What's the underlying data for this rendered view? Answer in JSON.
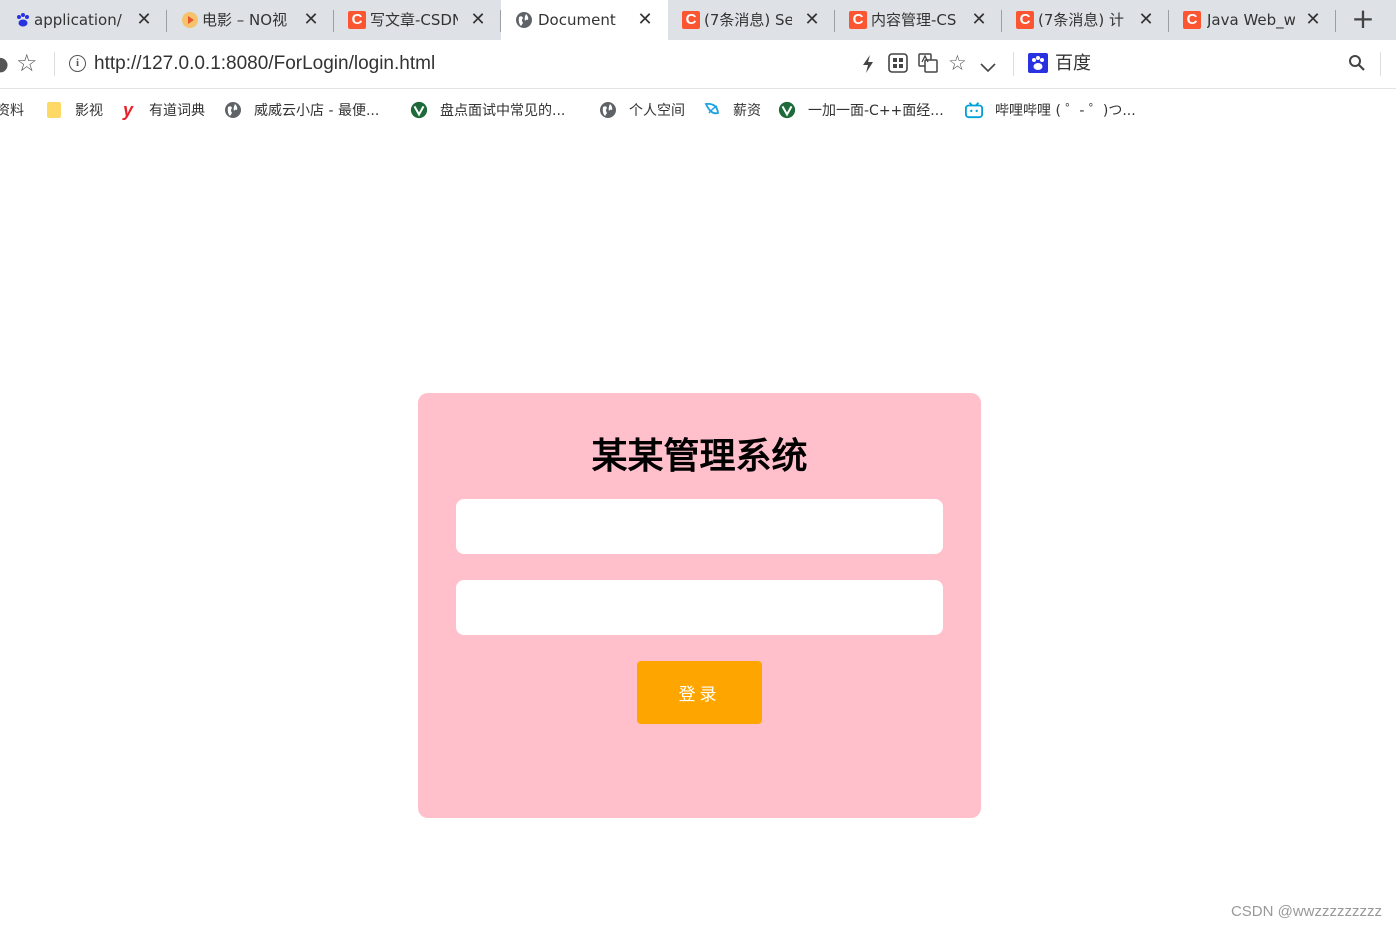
{
  "browser": {
    "tabs": [
      {
        "title": "application/",
        "favicon": "baidu-paw-icon",
        "active": false
      },
      {
        "title": "电影 – NO视",
        "favicon": "video-play-icon",
        "active": false
      },
      {
        "title": "写文章-CSDN",
        "favicon": "csdn-icon",
        "active": false
      },
      {
        "title": "Document",
        "favicon": "globe-icon",
        "active": true
      },
      {
        "title": "(7条消息) Se",
        "favicon": "csdn-icon",
        "active": false
      },
      {
        "title": "内容管理-CS",
        "favicon": "csdn-icon",
        "active": false
      },
      {
        "title": "(7条消息) 计",
        "favicon": "csdn-icon",
        "active": false
      },
      {
        "title": "Java Web_w",
        "favicon": "csdn-icon",
        "active": false
      }
    ],
    "close_glyph": "✕",
    "new_tab_glyph": "+",
    "address": "http://127.0.0.1:8080/ForLogin/login.html",
    "search_engine": "百度",
    "bookmarks": [
      {
        "label": "资料",
        "icon": "baidu-paw-icon"
      },
      {
        "label": "影视",
        "icon": "folder-icon"
      },
      {
        "label": "有道词典",
        "icon": "youdao-icon"
      },
      {
        "label": "威威云小店 - 最便...",
        "icon": "globe-icon"
      },
      {
        "label": "盘点面试中常见的...",
        "icon": "v-shield-icon"
      },
      {
        "label": "个人空间",
        "icon": "globe-icon"
      },
      {
        "label": "薪资",
        "icon": "leaf-icon"
      },
      {
        "label": "一加一面-C++面经...",
        "icon": "v-shield-icon"
      },
      {
        "label": "哔哩哔哩 ( ゜- ゜)つ...",
        "icon": "bilibili-icon"
      }
    ]
  },
  "login": {
    "title": "某某管理系统",
    "username_value": "",
    "password_value": "",
    "button_label": "登录"
  },
  "watermark": "CSDN @wwzzzzzzzzz",
  "colors": {
    "card_bg": "#ffc0cb",
    "button_bg": "#ffa500",
    "csdn_red": "#fc5531"
  }
}
